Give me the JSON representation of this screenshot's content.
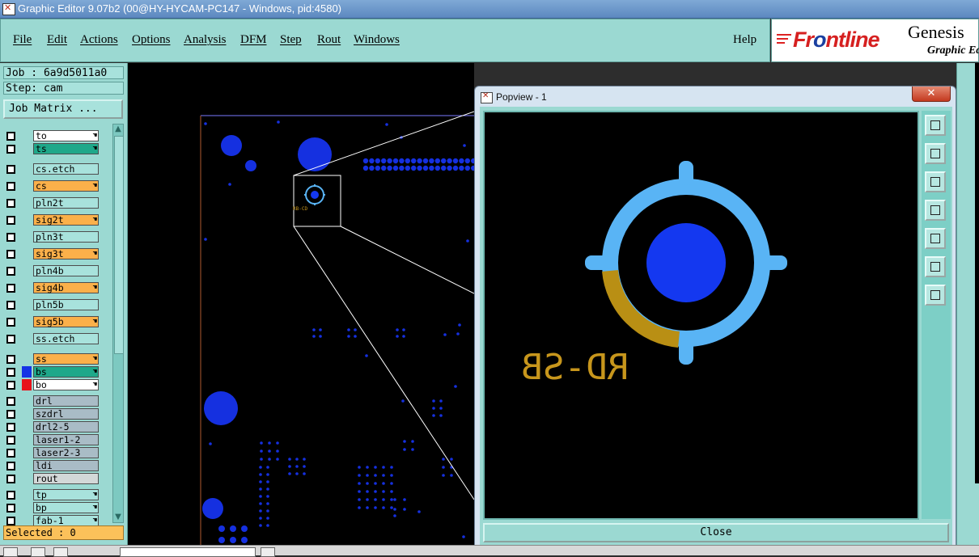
{
  "window": {
    "title": "Graphic Editor 9.07b2 (00@HY-HYCAM-PC147 - Windows, pid:4580)"
  },
  "menu": {
    "items": [
      "File",
      "Edit",
      "Actions",
      "Options",
      "Analysis",
      "DFM",
      "Step",
      "Rout",
      "Windows"
    ],
    "help": "Help"
  },
  "brand": {
    "logo_pre": "Fr",
    "logo_o": "o",
    "logo_post": "ntline",
    "product": "Genesis",
    "subproduct": "Graphic Ed"
  },
  "job": {
    "job_label": "Job : 6a9d5011a0",
    "step_label": "Step: cam",
    "matrix_button": "Job Matrix ..."
  },
  "layers": [
    {
      "name": "to",
      "bg": "#ffffff",
      "swatch": "",
      "hand": true
    },
    {
      "name": "ts",
      "bg": "#1fa88a",
      "swatch": "",
      "hand": true
    },
    {
      "name": "cs.etch",
      "bg": "#a8e2dc",
      "swatch": "",
      "hand": false
    },
    {
      "name": "cs",
      "bg": "#fbb04a",
      "swatch": "",
      "hand": true
    },
    {
      "name": "pln2t",
      "bg": "#a8e2dc",
      "swatch": "",
      "hand": false
    },
    {
      "name": "sig2t",
      "bg": "#fbb04a",
      "swatch": "",
      "hand": true
    },
    {
      "name": "pln3t",
      "bg": "#a8e2dc",
      "swatch": "",
      "hand": false
    },
    {
      "name": "sig3t",
      "bg": "#fbb04a",
      "swatch": "",
      "hand": true
    },
    {
      "name": "pln4b",
      "bg": "#a8e2dc",
      "swatch": "",
      "hand": false
    },
    {
      "name": "sig4b",
      "bg": "#fbb04a",
      "swatch": "",
      "hand": true
    },
    {
      "name": "pln5b",
      "bg": "#a8e2dc",
      "swatch": "",
      "hand": false
    },
    {
      "name": "sig5b",
      "bg": "#fbb04a",
      "swatch": "",
      "hand": true
    },
    {
      "name": "ss.etch",
      "bg": "#a8e2dc",
      "swatch": "",
      "hand": false
    },
    {
      "name": "ss",
      "bg": "#fbb04a",
      "swatch": "",
      "hand": true
    },
    {
      "name": "bs",
      "bg": "#1fa88a",
      "swatch": "#1533e6",
      "hand": true
    },
    {
      "name": "bo",
      "bg": "#ffffff",
      "swatch": "#e8121a",
      "hand": true
    },
    {
      "name": "drl",
      "bg": "#a9bcc6",
      "swatch": "",
      "hand": false
    },
    {
      "name": "szdrl",
      "bg": "#a9bcc6",
      "swatch": "",
      "hand": false
    },
    {
      "name": "drl2-5",
      "bg": "#a9bcc6",
      "swatch": "",
      "hand": false
    },
    {
      "name": "laser1-2",
      "bg": "#a9bcc6",
      "swatch": "",
      "hand": false
    },
    {
      "name": "laser2-3",
      "bg": "#a9bcc6",
      "swatch": "",
      "hand": false
    },
    {
      "name": "ldi",
      "bg": "#a9bcc6",
      "swatch": "",
      "hand": false
    },
    {
      "name": "rout",
      "bg": "#d3d8d8",
      "swatch": "",
      "hand": false
    },
    {
      "name": "tp",
      "bg": "#a8e2dc",
      "swatch": "",
      "hand": true
    },
    {
      "name": "bp",
      "bg": "#a8e2dc",
      "swatch": "",
      "hand": true
    },
    {
      "name": "fab-1",
      "bg": "#a8e2dc",
      "swatch": "",
      "hand": true
    }
  ],
  "status": {
    "selected": "Selected : 0"
  },
  "canvas": {
    "fiducial_label": "RB-CD"
  },
  "popview": {
    "title": "Popview - 1",
    "close_button": "Close",
    "fiducial_text": "RD-SB",
    "colors": {
      "ring": "#59b4f5",
      "pad": "#1438f0",
      "arc": "#b98f14",
      "text": "#c7961c"
    }
  },
  "colors": {
    "panel": "#9bd9d2",
    "board_pad": "#1530e0",
    "profile": "#7a7aff"
  }
}
